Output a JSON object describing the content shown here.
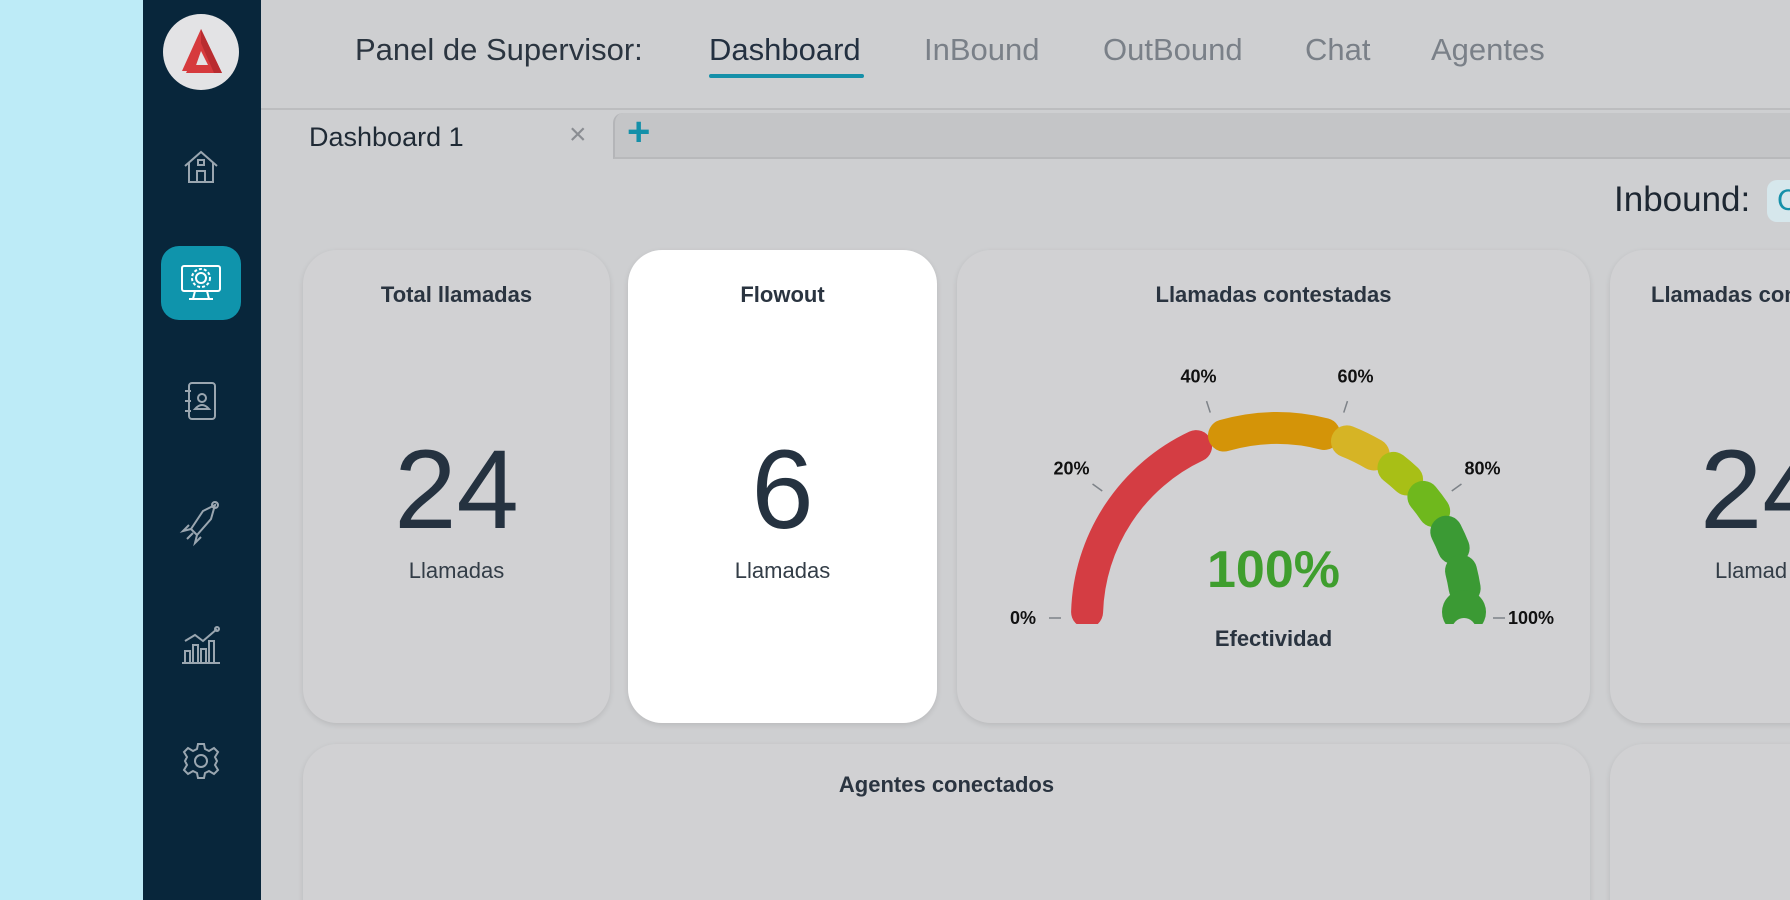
{
  "sidebar": {
    "items": [
      {
        "icon": "home-icon",
        "active": false
      },
      {
        "icon": "monitor-gear-icon",
        "active": true
      },
      {
        "icon": "contacts-book-icon",
        "active": false
      },
      {
        "icon": "rocket-icon",
        "active": false
      },
      {
        "icon": "analytics-chart-icon",
        "active": false
      },
      {
        "icon": "settings-gear-icon",
        "active": false
      }
    ],
    "accent": "#0f94ac",
    "background": "#08263b"
  },
  "header": {
    "title": "Panel de Supervisor:",
    "tabs": [
      "Dashboard",
      "InBound",
      "OutBound",
      "Chat",
      "Agentes"
    ],
    "active_tab": "Dashboard"
  },
  "dashboard_tabs": {
    "current": "Dashboard 1",
    "close_symbol": "×",
    "add_symbol": "+"
  },
  "filter": {
    "label": "Inbound:",
    "chip_text": "C"
  },
  "cards": {
    "total": {
      "title": "Total llamadas",
      "value": "24",
      "unit": "Llamadas"
    },
    "flowout": {
      "title": "Flowout",
      "value": "6",
      "unit": "Llamadas"
    },
    "contestadas": {
      "title": "Llamadas contestadas",
      "percent_text": "100%",
      "label": "Efectividad",
      "ticks": [
        "0%",
        "20%",
        "40%",
        "60%",
        "80%",
        "100%"
      ],
      "value": 1.0,
      "colors": [
        "#d43d43",
        "#d49408",
        "#d6b425",
        "#a8bf16",
        "#6fb81d",
        "#3b9a34"
      ]
    },
    "partial": {
      "title": "Llamadas con",
      "value": "24",
      "unit": "Llamad"
    },
    "agentes": {
      "title": "Agentes conectados"
    }
  }
}
